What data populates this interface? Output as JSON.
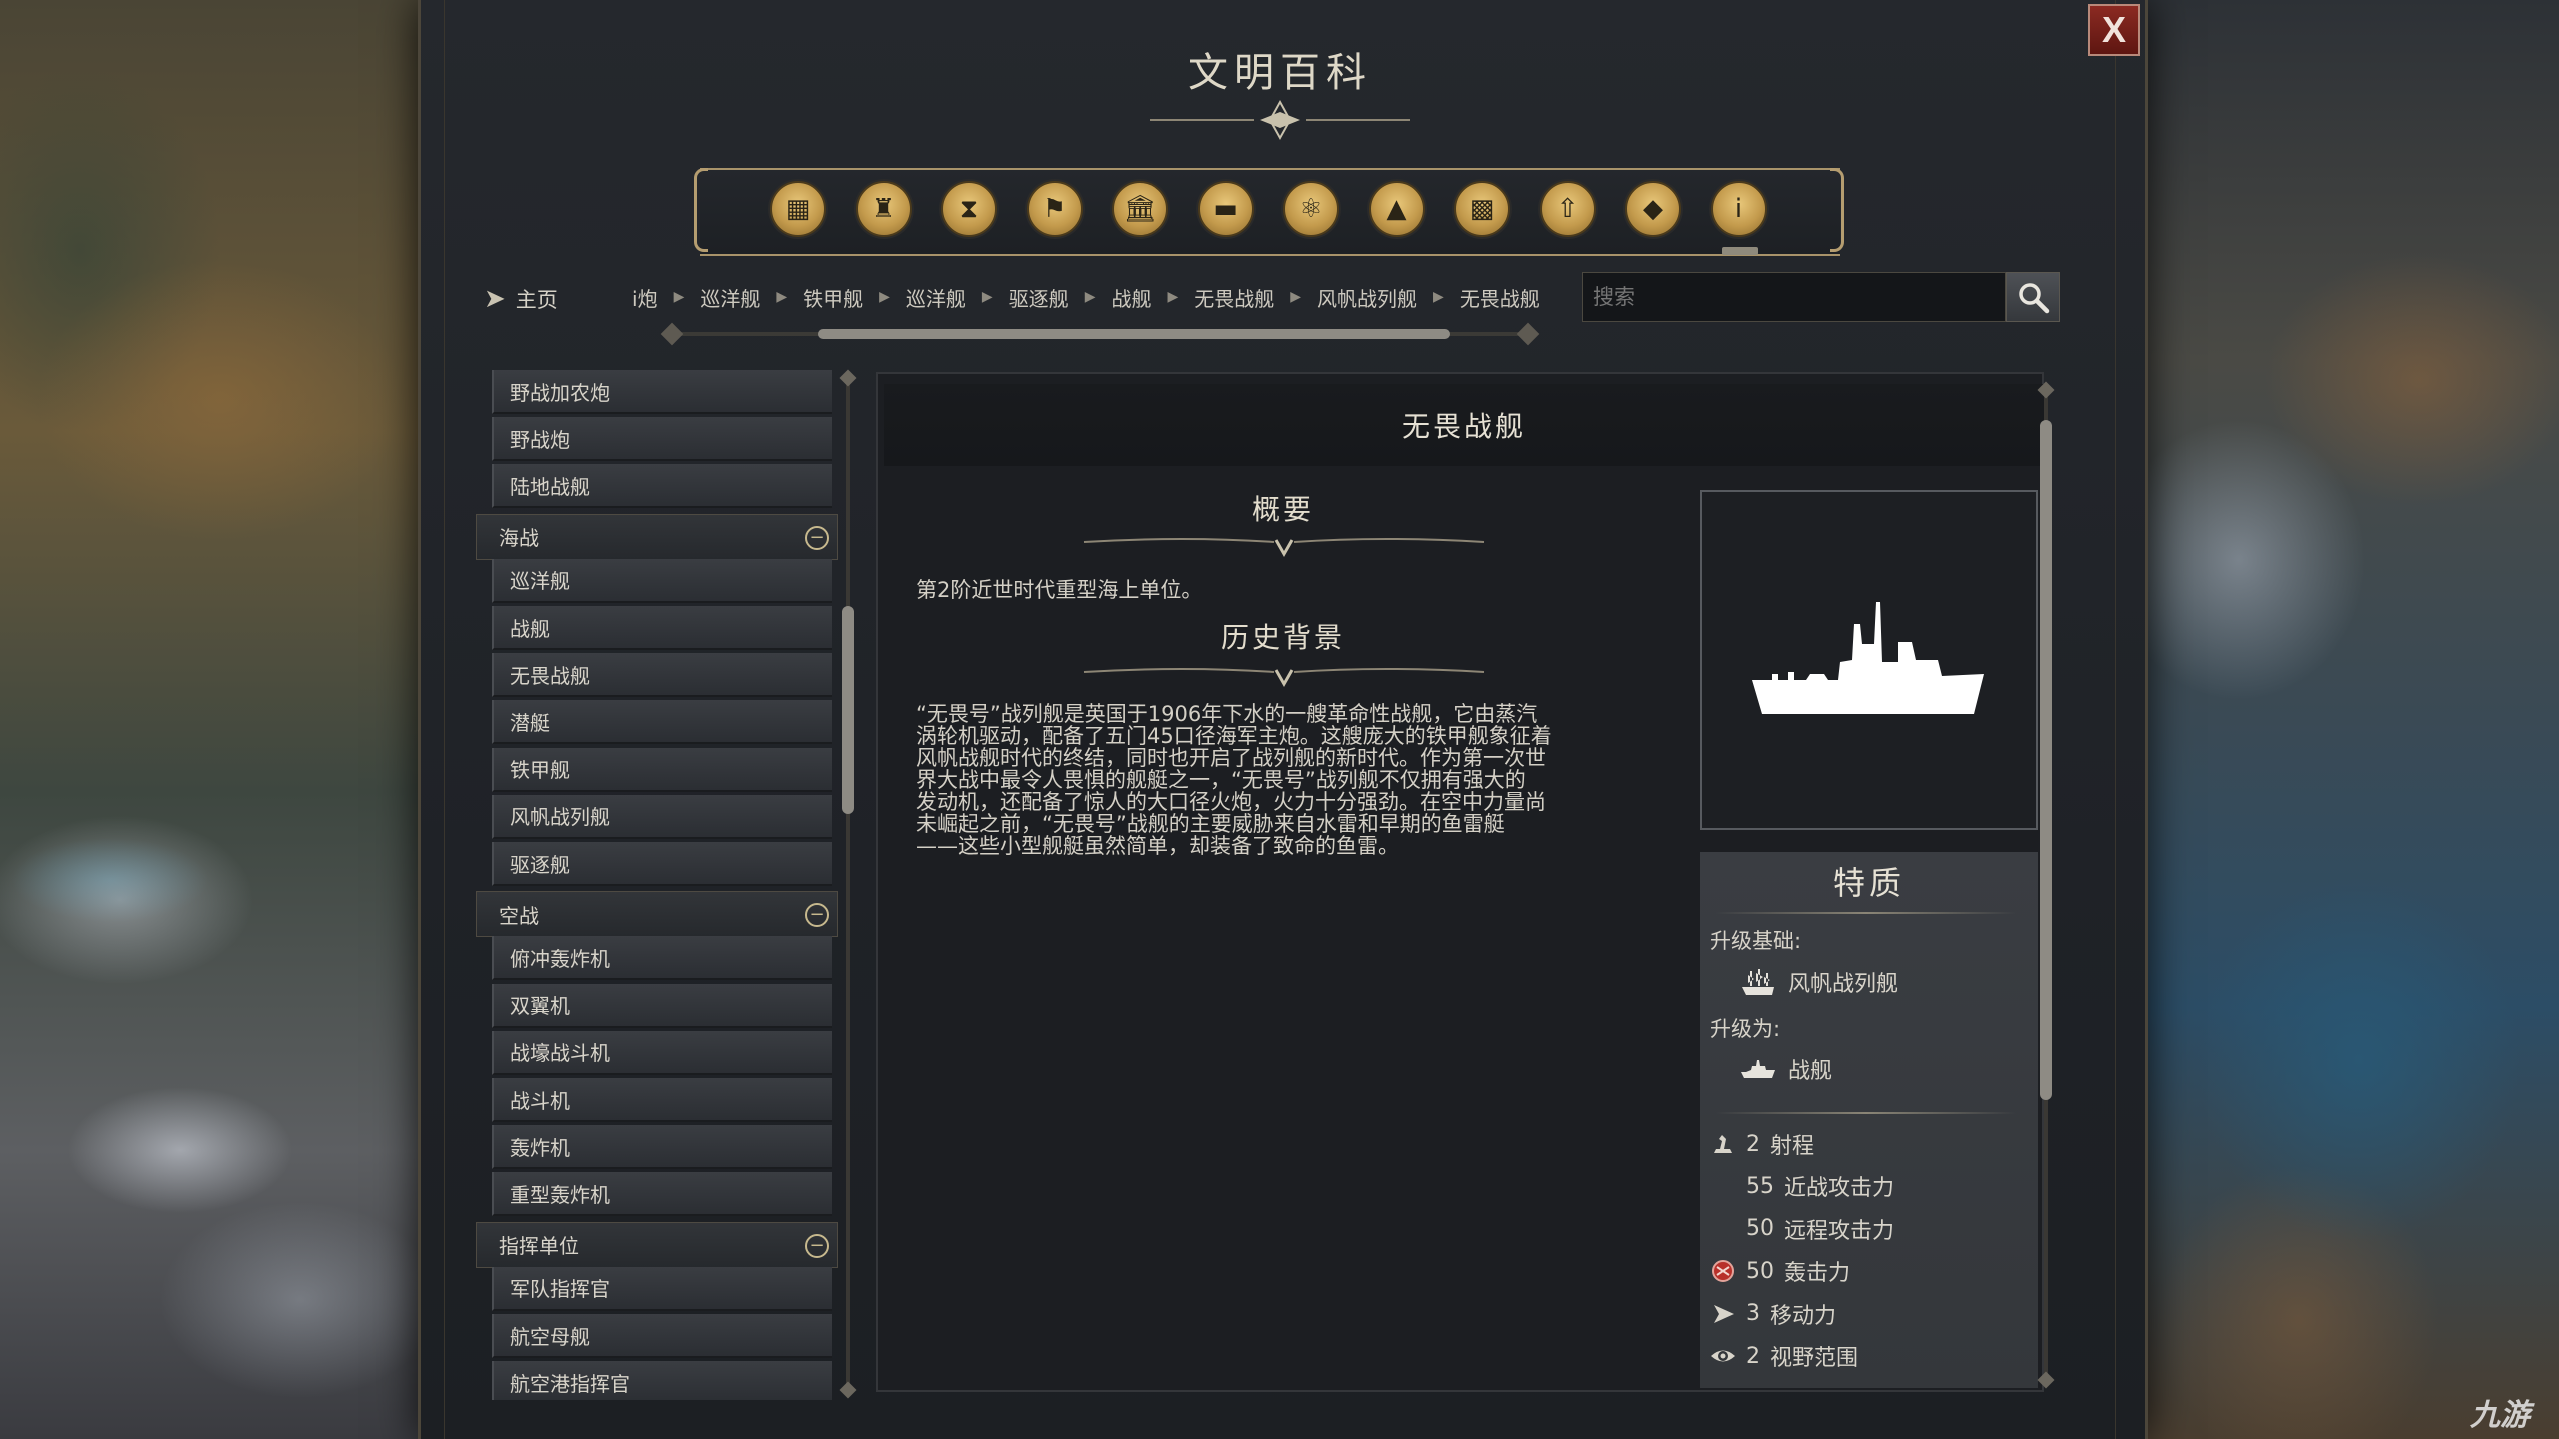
{
  "window": {
    "title": "文明百科",
    "close_label": "X"
  },
  "category_icons": [
    {
      "name": "general-icon",
      "glyph": "▦"
    },
    {
      "name": "civilizations-icon",
      "glyph": "♜"
    },
    {
      "name": "eras-icon",
      "glyph": "⧗"
    },
    {
      "name": "districts-icon",
      "glyph": "⚑"
    },
    {
      "name": "buildings-icon",
      "glyph": "🏛"
    },
    {
      "name": "culture-icon",
      "glyph": "▬"
    },
    {
      "name": "science-icon",
      "glyph": "⚛"
    },
    {
      "name": "terrain-icon",
      "glyph": "▲"
    },
    {
      "name": "city-icon",
      "glyph": "▩"
    },
    {
      "name": "units-icon",
      "glyph": "⇧"
    },
    {
      "name": "resources-icon",
      "glyph": "◆"
    },
    {
      "name": "info-icon",
      "glyph": "i"
    }
  ],
  "nav": {
    "home_label": "主页",
    "breadcrumb": [
      "і炮",
      "巡洋舰",
      "铁甲舰",
      "巡洋舰",
      "驱逐舰",
      "战舰",
      "无畏战舰",
      "风帆战列舰",
      "无畏战舰"
    ],
    "search_placeholder": "搜索"
  },
  "sidebar": {
    "top_items": [
      "野战加农炮",
      "野战炮",
      "陆地战舰"
    ],
    "categories": [
      {
        "label": "海战",
        "items": [
          "巡洋舰",
          "战舰",
          "无畏战舰",
          "潜艇",
          "铁甲舰",
          "风帆战列舰",
          "驱逐舰"
        ]
      },
      {
        "label": "空战",
        "items": [
          "俯冲轰炸机",
          "双翼机",
          "战壕战斗机",
          "战斗机",
          "轰炸机",
          "重型轰炸机"
        ]
      },
      {
        "label": "指挥单位",
        "items": [
          "军队指挥官",
          "航空母舰",
          "航空港指挥官"
        ]
      }
    ]
  },
  "article": {
    "title": "无畏战舰",
    "summary_heading": "概要",
    "summary": "第2阶近世时代重型海上单位。",
    "history_heading": "历史背景",
    "history_lines": [
      "“无畏号”战列舰是英国于1906年下水的一艘革命性战舰，它由蒸汽",
      "涡轮机驱动，配备了五门45口径海军主炮。这艘庞大的铁甲舰象征着",
      "风帆战舰时代的终结，同时也开启了战列舰的新时代。作为第一次世",
      "界大战中最令人畏惧的舰艇之一，“无畏号”战列舰不仅拥有强大的",
      "发动机，还配备了惊人的大口径火炮，火力十分强劲。在空中力量尚",
      "未崛起之前，“无畏号”战舰的主要威胁来自水雷和早期的鱼雷艇",
      "——这些小型舰艇虽然简单，却装备了致命的鱼雷。"
    ]
  },
  "traits": {
    "title": "特质",
    "upgrade_from_label": "升级基础:",
    "upgrade_from": "风帆战列舰",
    "upgrade_to_label": "升级为:",
    "upgrade_to": "战舰",
    "stats": [
      {
        "icon": "range-icon",
        "value": "2",
        "label": "射程"
      },
      {
        "icon": "melee-icon",
        "value": "55",
        "label": "近战攻击力"
      },
      {
        "icon": "ranged-icon",
        "value": "50",
        "label": "远程攻击力"
      },
      {
        "icon": "bombard-icon",
        "value": "50",
        "label": "轰击力"
      },
      {
        "icon": "movement-icon",
        "value": "3",
        "label": "移动力"
      },
      {
        "icon": "sight-icon",
        "value": "2",
        "label": "视野范围"
      }
    ]
  },
  "watermark": "九游"
}
